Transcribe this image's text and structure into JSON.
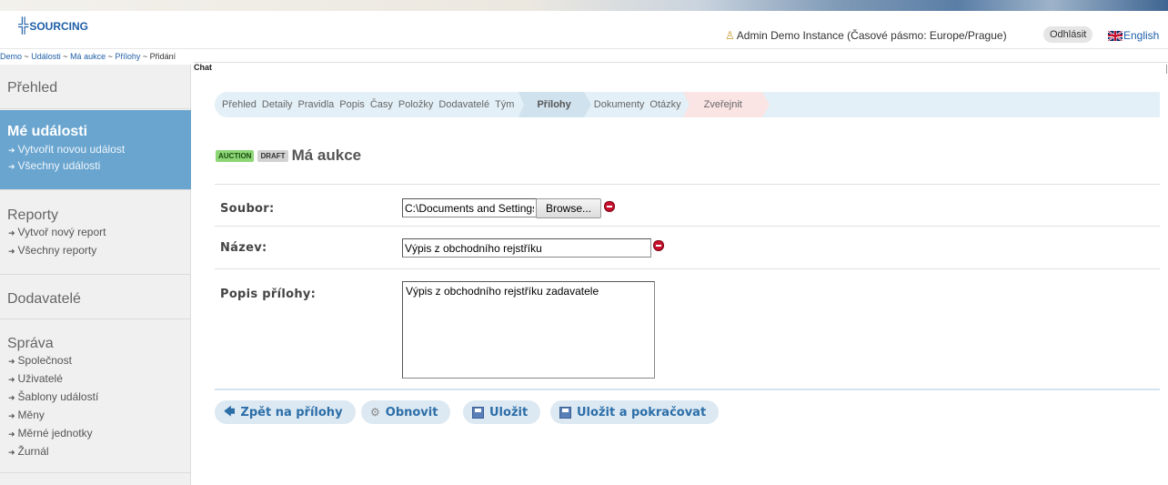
{
  "header": {
    "logo_text": "SOURCING",
    "user_text": "Admin Demo Instance (Časové pásmo: Europe/Prague)",
    "logout_label": "Odhlásit",
    "language_label": "English"
  },
  "breadcrumb": {
    "items": [
      "Demo",
      "Události",
      "Má aukce",
      "Přílohy"
    ],
    "current": "Přidání",
    "separator": " ~ "
  },
  "chat": {
    "label": "Chat"
  },
  "sidebar": {
    "overview": {
      "title": "Přehled"
    },
    "my_events": {
      "title": "Mé události",
      "links": [
        "Vytvořit novou událost",
        "Všechny události"
      ]
    },
    "reports": {
      "title": "Reporty",
      "links": [
        "Vytvoř nový report",
        "Všechny reporty"
      ]
    },
    "suppliers": {
      "title": "Dodavatelé"
    },
    "admin": {
      "title": "Správa",
      "links": [
        "Společnost",
        "Uživatelé",
        "Šablony událostí",
        "Měny",
        "Měrné jednotky",
        "Žurnál"
      ]
    }
  },
  "steps": {
    "items": [
      "Přehled",
      "Detaily",
      "Pravidla",
      "Popis",
      "Časy",
      "Položky",
      "Dodavatelé",
      "Tým"
    ],
    "active": "Přílohy",
    "after": [
      "Dokumenty",
      "Otázky"
    ],
    "publish": "Zveřejnit"
  },
  "event": {
    "badge_type": "AUCTION",
    "badge_status": "DRAFT",
    "title": "Má aukce"
  },
  "form": {
    "file_label": "Soubor:",
    "file_value": "C:\\Documents and Settings",
    "browse_label": "Browse...",
    "name_label": "Název:",
    "name_value": "Výpis z obchodního rejstříku",
    "desc_label": "Popis přílohy:",
    "desc_value": "Výpis z obchodního rejstříku zadavatele"
  },
  "actions": {
    "back_label": "Zpět na přílohy",
    "refresh_label": "Obnovit",
    "save_label": "Uložit",
    "save_continue_label": "Uložit a pokračovat"
  },
  "colors": {
    "brand_blue": "#1f5fa8",
    "sidebar_active": "#6aa5cf",
    "step_bar": "#e3f0f7",
    "publish_step": "#fbe4e4",
    "badge_auction": "#8cd675",
    "required_icon": "#c8102e"
  }
}
